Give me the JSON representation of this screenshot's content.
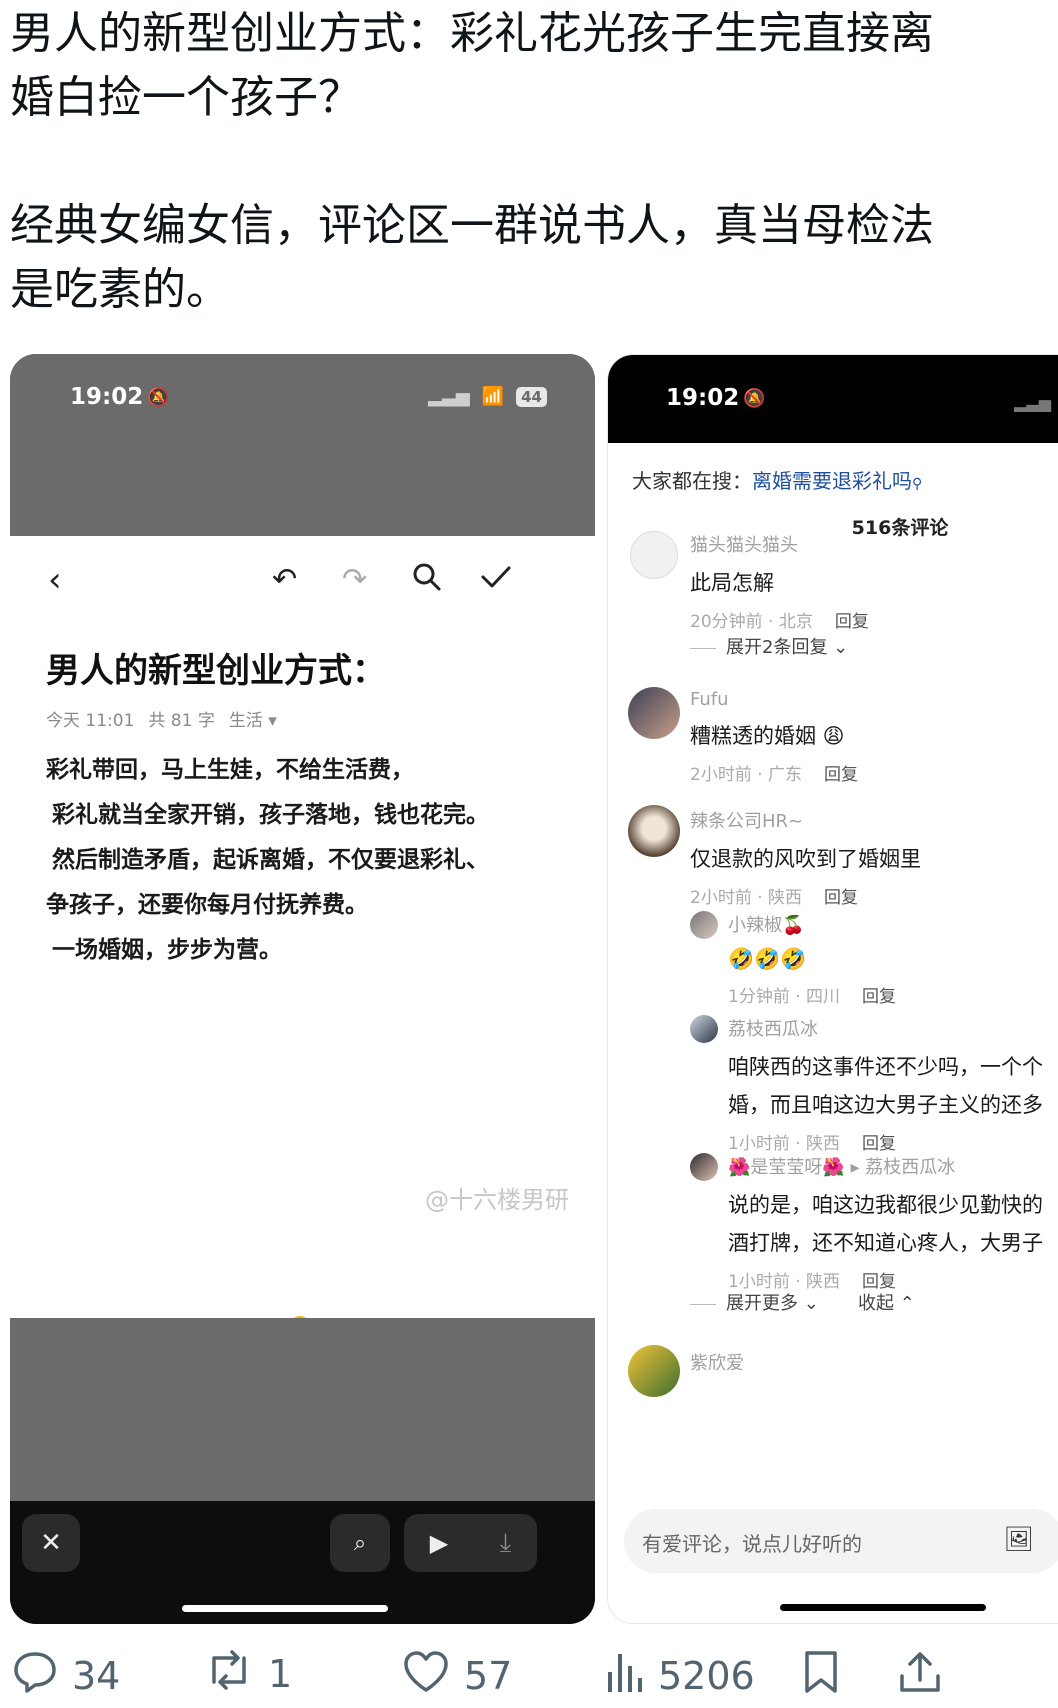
{
  "post": {
    "line1": "男人的新型创业方式：彩礼花光孩子生完直接离",
    "line2": "婚白捡一个孩子？",
    "line3": "经典女编女信，评论区一群说书人，真当母检法",
    "line4": "是吃素的。"
  },
  "left_phone": {
    "time": "19:02",
    "battery": "44",
    "note_title": "男人的新型创业方式：",
    "meta_date": "今天 11:01",
    "meta_count": "共 81 字",
    "meta_category": "生活 ▾",
    "body": [
      "彩礼带回，马上生娃，不给生活费，",
      "彩礼就当全家开销，孩子落地，钱也花完。",
      "然后制造矛盾，起诉离婚，不仅要退彩礼、",
      "争孩子，还要你每月付抚养费。",
      "一场婚姻，步步为营。"
    ],
    "watermark": "@十六楼男研"
  },
  "right_phone": {
    "time": "19:02",
    "search_prefix": "大家都在搜：",
    "search_query": "离婚需要退彩礼吗",
    "comment_count": "516条评论",
    "comments": [
      {
        "name": "猫头猫头猫头",
        "text": "此局怎解",
        "meta": "20分钟前 · 北京",
        "reply": "回复",
        "expand": "展开2条回复 ⌄"
      },
      {
        "name": "Fufu",
        "text": "糟糕透的婚姻 😩",
        "meta": "2小时前 · 广东",
        "reply": "回复"
      },
      {
        "name": "辣条公司HR~",
        "text": "仅退款的风吹到了婚姻里",
        "meta": "2小时前 · 陕西",
        "reply": "回复"
      },
      {
        "name": "小辣椒🍒",
        "text": "🤣🤣🤣",
        "meta": "1分钟前 · 四川",
        "reply": "回复"
      },
      {
        "name": "荔枝西瓜冰",
        "text1": "咱陕西的这事件还不少吗，一个个",
        "text2": "婚，而且咱这边大男子主义的还多",
        "meta": "1小时前 · 陕西",
        "reply": "回复"
      },
      {
        "name": "🌺是莹莹呀🌺 ▸ 荔枝西瓜冰",
        "text1": "说的是，咱这边我都很少见勤快的",
        "text2": "酒打牌，还不知道心疼人，大男子",
        "meta": "1小时前 · 陕西",
        "reply": "回复"
      },
      {
        "name": "紫欣爱"
      }
    ],
    "expand_more": "展开更多 ⌄",
    "collapse": "收起 ⌃",
    "comment_placeholder": "有爱评论，说点儿好听的"
  },
  "engagement": {
    "replies": "34",
    "reposts": "1",
    "likes": "57",
    "views": "5206"
  }
}
